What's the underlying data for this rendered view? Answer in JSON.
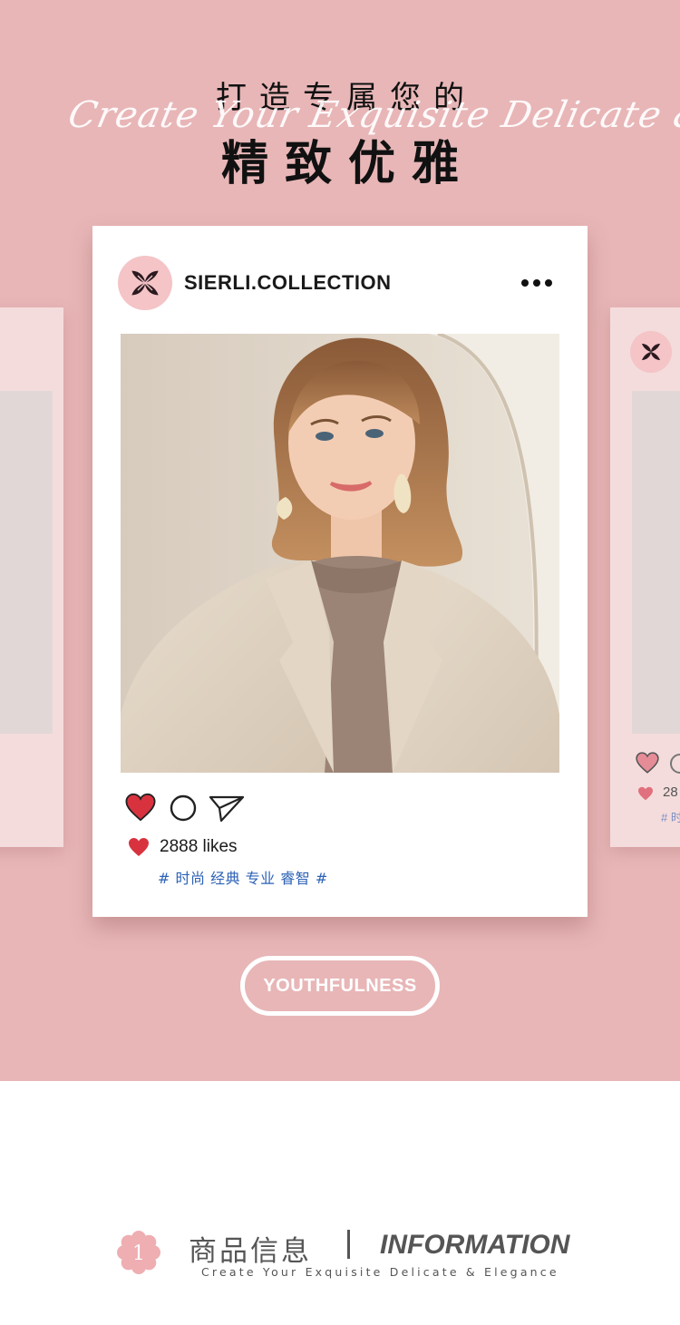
{
  "hero": {
    "title_top": "打造专属您的",
    "script_text": "Create Your Exquisite Delicate & Elegance",
    "title_main": "精致优雅",
    "background_color": "#e8b6b7"
  },
  "post": {
    "username": "SIERLI.COLLECTION",
    "more_icon": "more-dots-icon",
    "likes_text": "2888 likes",
    "tags": "# 时尚 经典 专业 睿智 #",
    "like_color": "#d9323f",
    "tag_color": "#2d62b6"
  },
  "side_card_right": {
    "likes_text": "28",
    "tags_text": "# 时"
  },
  "button": {
    "label": "YOUTHFULNESS"
  },
  "info": {
    "number": "1",
    "cn_title": "商品信息",
    "en_title": "INFORMATION",
    "subtitle": "Create Your Exquisite Delicate & Elegance"
  }
}
